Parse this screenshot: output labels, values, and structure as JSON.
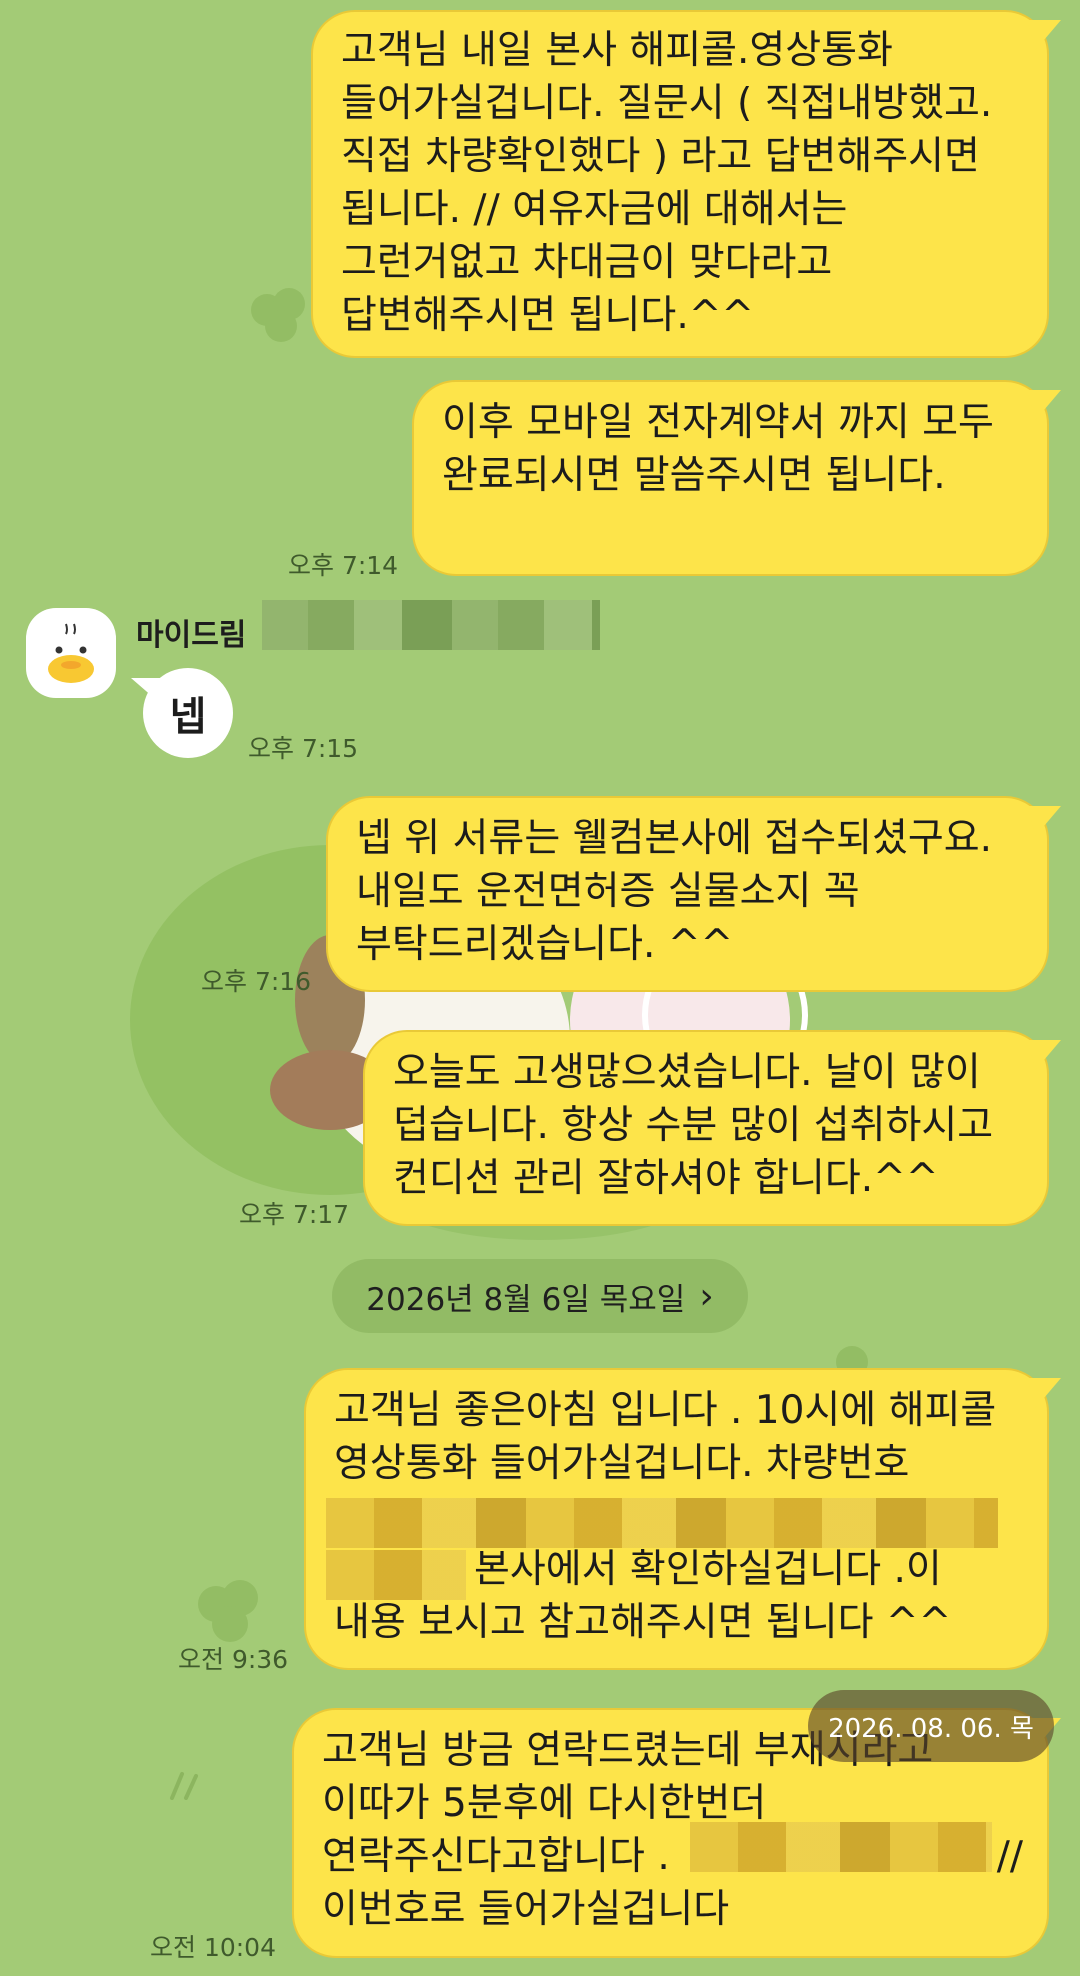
{
  "sender": {
    "name": "마이드림"
  },
  "date_divider": {
    "label": "2026년 8월 6일 목요일",
    "arrow": "›"
  },
  "date_tooltip": "2026. 08. 06. 목",
  "messages": [
    {
      "lines": [
        "고객님 내일 본사 해피콜.영상통화",
        "들어가실겁니다. 질문시 ( 직접내방했고.",
        "직접 차량확인했다 ) 라고 답변해주시면",
        "됩니다. // 여유자금에 대해서는",
        "그런거없고 차대금이 맞다라고",
        "답변해주시면 됩니다.^^"
      ]
    },
    {
      "lines": [
        "이후 모바일 전자계약서 까지 모두",
        "완료되시면 말씀주시면 됩니다."
      ],
      "time": "오후 7:14"
    },
    {
      "incoming": true,
      "text": "넵",
      "time": "오후 7:15"
    },
    {
      "lines": [
        "넵 위 서류는 웰컴본사에 접수되셨구요.",
        "내일도 운전면허증 실물소지 꼭",
        "부탁드리겠습니다. ^^"
      ],
      "time": "오후 7:16"
    },
    {
      "lines": [
        "오늘도 고생많으셨습니다. 날이 많이",
        "덥습니다. 항상 수분 많이 섭취하시고",
        "컨디션 관리 잘하셔야 합니다.^^"
      ],
      "time": "오후 7:17"
    },
    {
      "lines": [
        "고객님 좋은아침 입니다 . 10시에 해피콜",
        "영상통화 들어가실겁니다. 차량번호",
        "",
        "본사에서 확인하실겁니다 .이",
        "내용 보시고 참고해주시면 됩니다 ^^"
      ],
      "time": "오전 9:36"
    },
    {
      "lines": [
        "고객님 방금 연락드렸는데 부재시라고",
        "이따가 5분후에 다시한번더",
        "연락주신다고합니다 .",
        "이번호로 들어가실겁니다"
      ],
      "tail_text": "//",
      "time": "오전 10:04"
    }
  ]
}
